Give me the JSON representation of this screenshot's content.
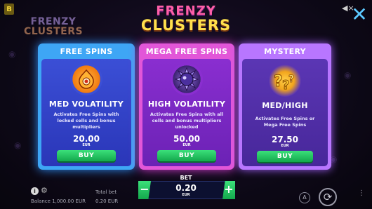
{
  "top": {
    "badge": "B",
    "logo_line1": "FRENZY",
    "logo_line2": "CLUSTERS",
    "title_line1": "FRENZY",
    "title_line2": "CLUSTERS"
  },
  "cards": [
    {
      "header": "FREE SPINS",
      "volatility": "MED VOLATILITY",
      "description": "Activates Free Spins with locked cells and bonus multipliers",
      "price": "20.00",
      "currency": "EUR",
      "buy_label": "BUY"
    },
    {
      "header": "MEGA FREE SPINS",
      "volatility": "HIGH VOLATILITY",
      "description": "Activates Free Spins with all cells and bonus multipliers unlocked",
      "price": "50.00",
      "currency": "EUR",
      "buy_label": "BUY"
    },
    {
      "header": "MYSTERY",
      "volatility": "MED/HIGH",
      "description": "Activates Free Spins or Mega Free Spins",
      "price": "27.50",
      "currency": "EUR",
      "buy_label": "BUY"
    }
  ],
  "bet": {
    "label": "BET",
    "value": "0.20",
    "currency": "EUR",
    "minus": "−",
    "plus": "+"
  },
  "footer": {
    "info": "i",
    "balance": "Balance 1,000.00 EUR",
    "total_bet_label": "Total bet",
    "total_bet_value": "0.20 EUR",
    "auto_label": "A"
  },
  "colors": {
    "free_spins_border": "#3ea6f5",
    "mega_free_spins_border": "#e256d8",
    "mystery_border": "#b876ff",
    "buy_button": "#13a84c",
    "close_icon": "#5cc9ff"
  }
}
